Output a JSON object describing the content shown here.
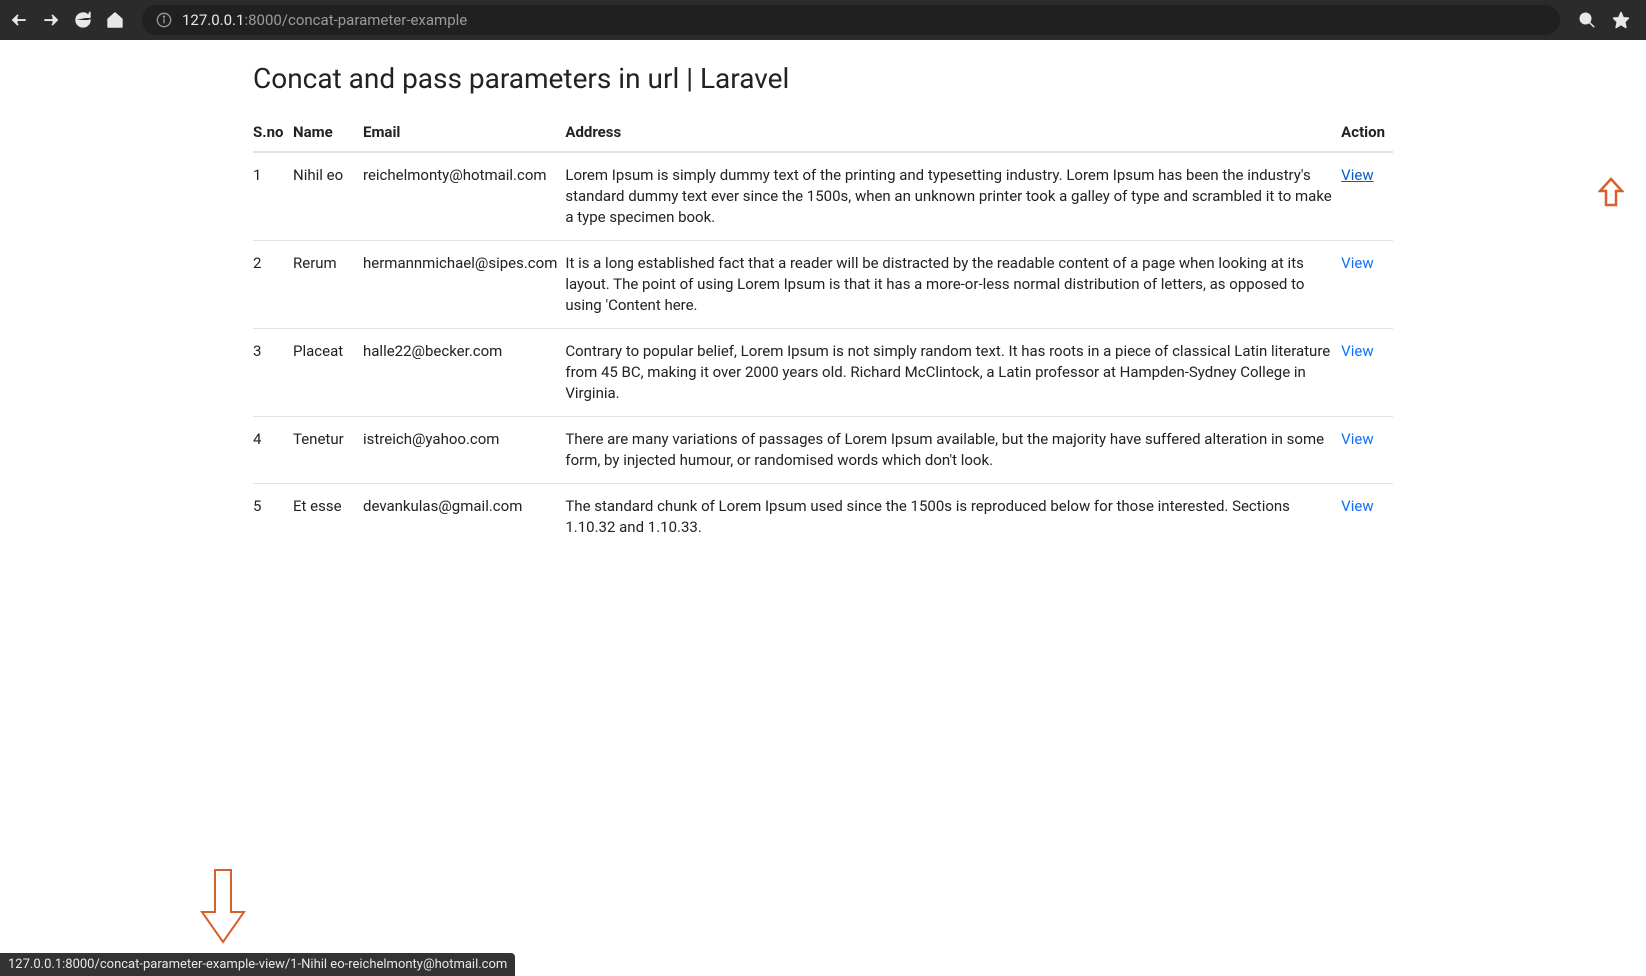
{
  "browser": {
    "url_host": "127.0.0.1",
    "url_rest": ":8000/concat-parameter-example"
  },
  "page": {
    "title": "Concat and pass parameters in url | Laravel"
  },
  "table": {
    "headers": {
      "sno": "S.no",
      "name": "Name",
      "email": "Email",
      "address": "Address",
      "action": "Action"
    },
    "rows": [
      {
        "sno": "1",
        "name": "Nihil eo",
        "email": "reichelmonty@hotmail.com",
        "address": "Lorem Ipsum is simply dummy text of the printing and typesetting industry. Lorem Ipsum has been the industry's standard dummy text ever since the 1500s, when an unknown printer took a galley of type and scrambled it to make a type specimen book.",
        "action": "View"
      },
      {
        "sno": "2",
        "name": "Rerum",
        "email": "hermannmichael@sipes.com",
        "address": "It is a long established fact that a reader will be distracted by the readable content of a page when looking at its layout. The point of using Lorem Ipsum is that it has a more-or-less normal distribution of letters, as opposed to using 'Content here.",
        "action": "View"
      },
      {
        "sno": "3",
        "name": "Placeat",
        "email": "halle22@becker.com",
        "address": "Contrary to popular belief, Lorem Ipsum is not simply random text. It has roots in a piece of classical Latin literature from 45 BC, making it over 2000 years old. Richard McClintock, a Latin professor at Hampden-Sydney College in Virginia.",
        "action": "View"
      },
      {
        "sno": "4",
        "name": "Tenetur",
        "email": "istreich@yahoo.com",
        "address": "There are many variations of passages of Lorem Ipsum available, but the majority have suffered alteration in some form, by injected humour, or randomised words which don't look.",
        "action": "View"
      },
      {
        "sno": "5",
        "name": "Et esse",
        "email": "devankulas@gmail.com",
        "address": "The standard chunk of Lorem Ipsum used since the 1500s is reproduced below for those interested. Sections 1.10.32 and 1.10.33.",
        "action": "View"
      }
    ]
  },
  "status_bar": "127.0.0.1:8000/concat-parameter-example-view/1-Nihil eo-reichelmonty@hotmail.com"
}
